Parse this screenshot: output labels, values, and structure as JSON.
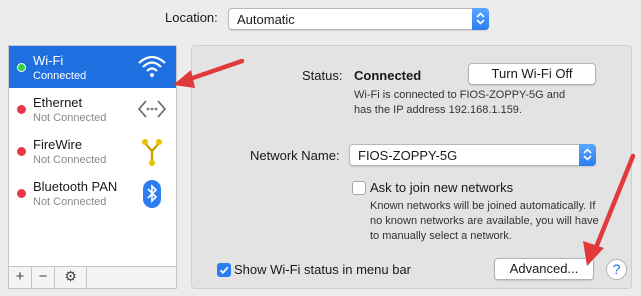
{
  "location": {
    "label": "Location:",
    "value": "Automatic"
  },
  "sidebar": {
    "services": [
      {
        "name": "Wi-Fi",
        "status": "Connected",
        "icon": "wifi-icon",
        "dot_color": "#2fd33f"
      },
      {
        "name": "Ethernet",
        "status": "Not Connected",
        "icon": "ethernet-icon",
        "dot_color": "#e8394a"
      },
      {
        "name": "FireWire",
        "status": "Not Connected",
        "icon": "firewire-icon",
        "dot_color": "#e8394a"
      },
      {
        "name": "Bluetooth PAN",
        "status": "Not Connected",
        "icon": "bluetooth-icon",
        "dot_color": "#e8394a"
      }
    ],
    "toolbar": {
      "add": "+",
      "remove": "−",
      "gear": "⚙"
    }
  },
  "detail": {
    "status_label": "Status:",
    "status_value": "Connected",
    "turn_off_button": "Turn Wi-Fi Off",
    "status_desc_1": "Wi-Fi is connected to FIOS-ZOPPY-5G and",
    "status_desc_2": "has the IP address 192.168.1.159.",
    "network_name_label": "Network Name:",
    "network_name_value": "FIOS-ZOPPY-5G",
    "ask_join_label": "Ask to join new networks",
    "ask_join_checked": false,
    "ask_join_desc_1": "Known networks will be joined automatically. If",
    "ask_join_desc_2": "no known networks are available, you will have",
    "ask_join_desc_3": "to manually select a network.",
    "show_status_label": "Show Wi-Fi status in menu bar",
    "show_status_checked": true,
    "advanced_button": "Advanced...",
    "help_button": "?"
  },
  "colors": {
    "selection": "#1f6fe0",
    "accent": "#2b7df1",
    "annotation_arrow": "#e23a3a"
  }
}
